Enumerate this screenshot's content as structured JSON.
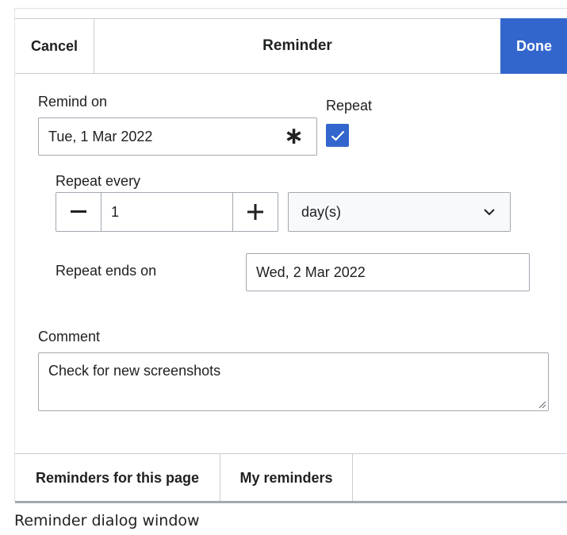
{
  "header": {
    "cancel_label": "Cancel",
    "title": "Reminder",
    "done_label": "Done"
  },
  "remind_on": {
    "label": "Remind on",
    "value": "Tue, 1 Mar 2022",
    "required_marker": "∗"
  },
  "repeat": {
    "label": "Repeat",
    "checked": true
  },
  "repeat_every": {
    "label": "Repeat every",
    "minus_icon": "minus-icon",
    "value": "1",
    "plus_icon": "plus-icon",
    "unit_selected": "day(s)"
  },
  "repeat_ends": {
    "label": "Repeat ends on",
    "value": "Wed, 2 Mar 2022"
  },
  "comment": {
    "label": "Comment",
    "value": "Check for new screenshots"
  },
  "footer": {
    "tabs": [
      {
        "label": "Reminders for this page"
      },
      {
        "label": "My reminders"
      }
    ]
  },
  "caption": "Reminder dialog window",
  "colors": {
    "accent": "#3366cc",
    "border": "#a2a9b1",
    "text": "#202122"
  }
}
